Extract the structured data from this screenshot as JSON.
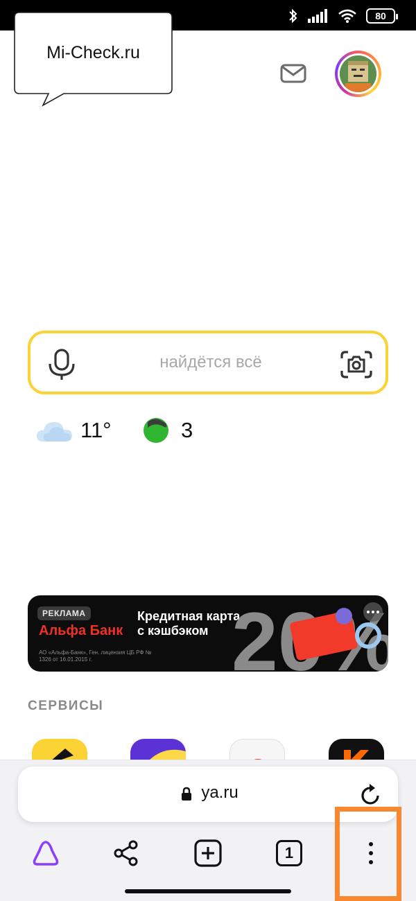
{
  "watermark": {
    "text": "Mi-Check.ru"
  },
  "status_bar": {
    "battery_level": "80",
    "icons": [
      "bluetooth-icon",
      "signal-icon",
      "wifi-icon",
      "battery-icon"
    ]
  },
  "header": {
    "mail_icon": "mail-icon",
    "avatar": "avatar"
  },
  "search": {
    "placeholder": "найдётся всё",
    "left_icon": "microphone-icon",
    "right_icon": "camera-icon",
    "border_color": "#fcd335"
  },
  "informers": {
    "temperature": "11°",
    "traffic_score": "3",
    "weather_icon": "cloud-icon",
    "traffic_icon": "traffic-light-icon"
  },
  "ad": {
    "label": "РЕКЛАМА",
    "brand": "Альфа Банк",
    "title": "Кредитная карта с кэшбэком",
    "legal": "АО «Альфа-Банк», Ген. лицензия ЦБ РФ № 1326 от 16.01.2015 г.",
    "promo_graphic": "20%"
  },
  "services": {
    "heading": "СЕРВИСЫ"
  },
  "browser": {
    "url": "ya.ru",
    "toolbar": {
      "alice": "alice-icon",
      "share": "share-icon",
      "new_tab": "new-tab-icon",
      "tabs_count": "1",
      "menu": "more-vertical-icon"
    }
  },
  "colors": {
    "accent_yellow": "#fcd335",
    "alfa_red": "#ef3124",
    "alice_purple": "#8b3ffd",
    "highlight_orange": "#f7882f"
  }
}
